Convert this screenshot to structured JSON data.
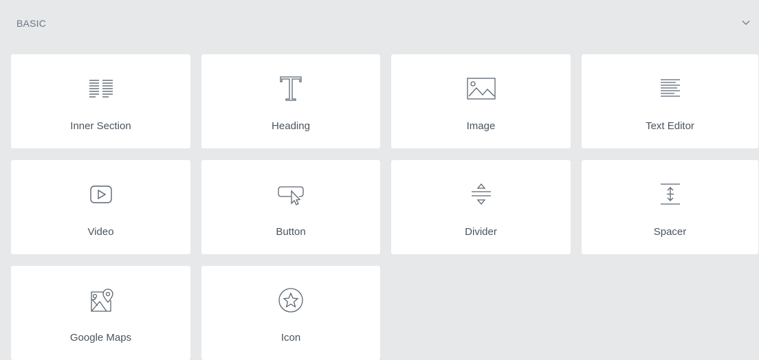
{
  "section": {
    "title": "BASIC",
    "collapse_icon": "chevron-down-icon"
  },
  "widgets": [
    {
      "label": "Inner Section",
      "icon": "inner-section-icon"
    },
    {
      "label": "Heading",
      "icon": "heading-icon"
    },
    {
      "label": "Image",
      "icon": "image-icon"
    },
    {
      "label": "Text Editor",
      "icon": "text-editor-icon"
    },
    {
      "label": "Video",
      "icon": "video-icon"
    },
    {
      "label": "Button",
      "icon": "button-icon"
    },
    {
      "label": "Divider",
      "icon": "divider-icon"
    },
    {
      "label": "Spacer",
      "icon": "spacer-icon"
    },
    {
      "label": "Google Maps",
      "icon": "google-maps-icon"
    },
    {
      "label": "Icon",
      "icon": "star-icon"
    }
  ],
  "colors": {
    "panel_background": "#e6e8ea",
    "tile_background": "#ffffff",
    "header_text": "#6d7882",
    "label_text": "#4a535b",
    "icon_stroke": "#5b6570"
  }
}
